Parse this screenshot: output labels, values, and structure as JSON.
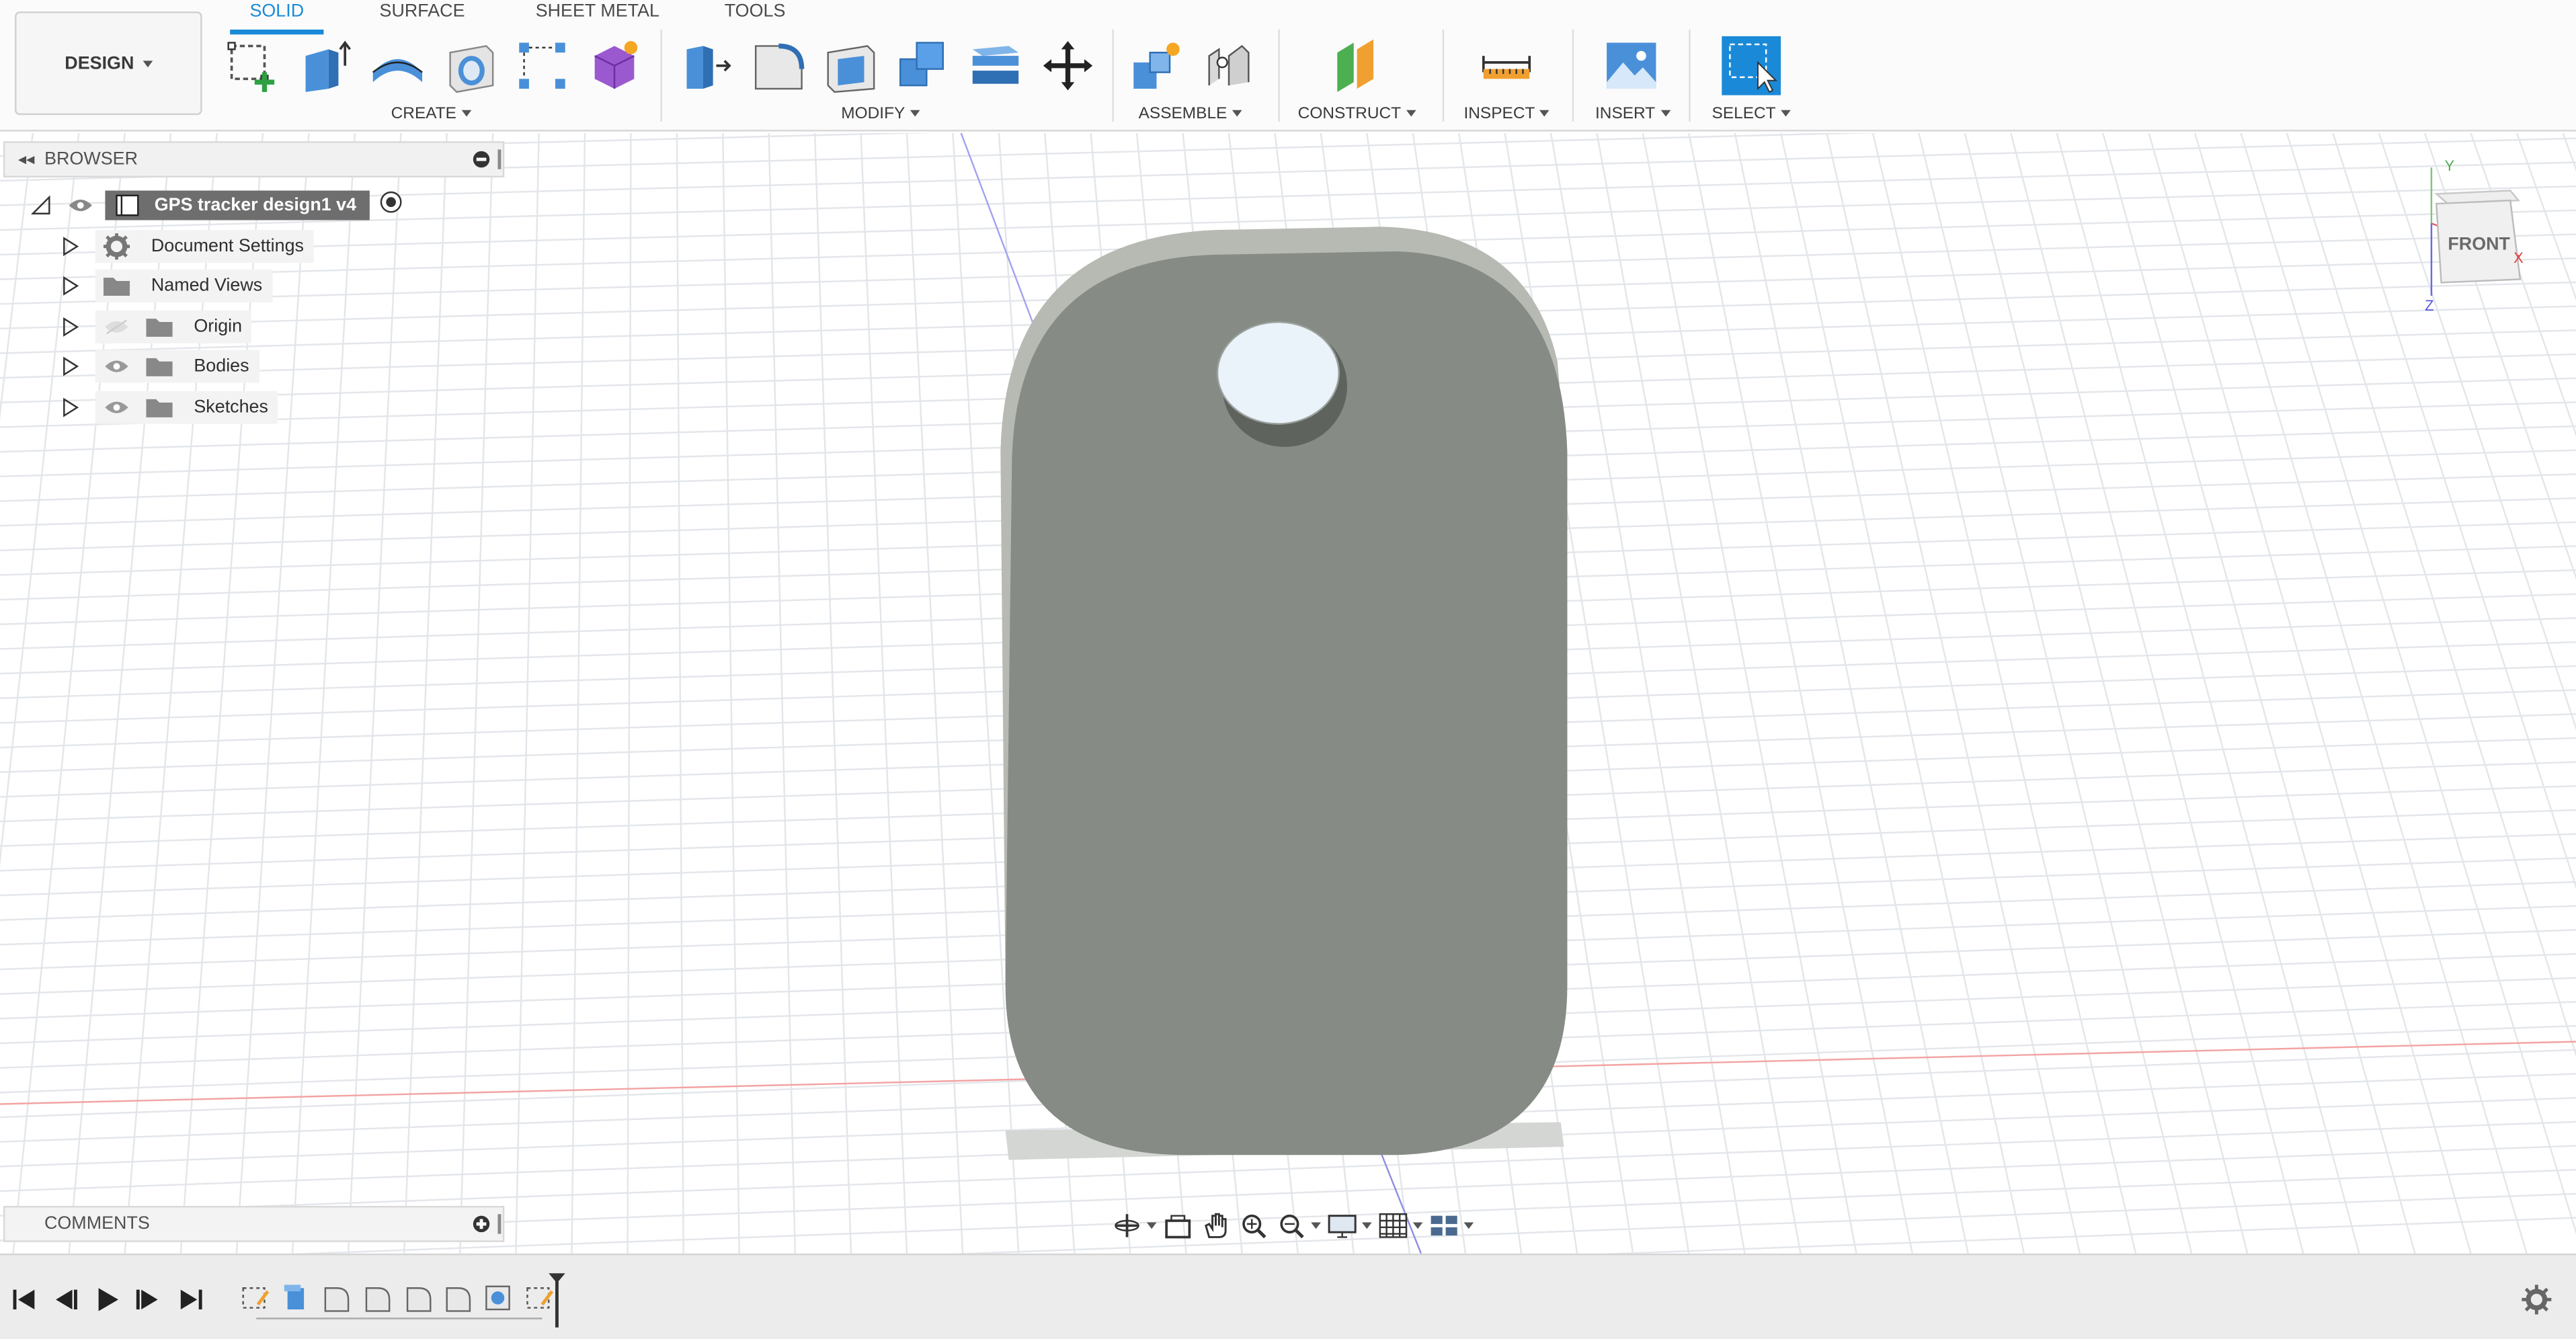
{
  "workspace": {
    "label": "DESIGN"
  },
  "tabs": [
    {
      "label": "SOLID",
      "active": true
    },
    {
      "label": "SURFACE",
      "active": false
    },
    {
      "label": "SHEET METAL",
      "active": false
    },
    {
      "label": "TOOLS",
      "active": false
    }
  ],
  "groups": {
    "create": "CREATE",
    "modify": "MODIFY",
    "assemble": "ASSEMBLE",
    "construct": "CONSTRUCT",
    "inspect": "INSPECT",
    "insert": "INSERT",
    "select": "SELECT"
  },
  "browser": {
    "title": "BROWSER",
    "root": "GPS tracker design1 v4",
    "items": [
      {
        "label": "Document Settings",
        "icon": "gear-icon"
      },
      {
        "label": "Named Views",
        "icon": "folder-icon"
      },
      {
        "label": "Origin",
        "icon": "folder-icon",
        "hidden": true
      },
      {
        "label": "Bodies",
        "icon": "folder-icon"
      },
      {
        "label": "Sketches",
        "icon": "folder-icon"
      }
    ]
  },
  "comments": {
    "title": "COMMENTS"
  },
  "viewcube": {
    "face": "FRONT",
    "axis_x": "X",
    "axis_y": "Y",
    "axis_z": "Z"
  },
  "colors": {
    "accent": "#1a8ad8",
    "body": "#868b85",
    "body_edge": "#b8bcb5",
    "root_chip": "#6e6e6e"
  }
}
